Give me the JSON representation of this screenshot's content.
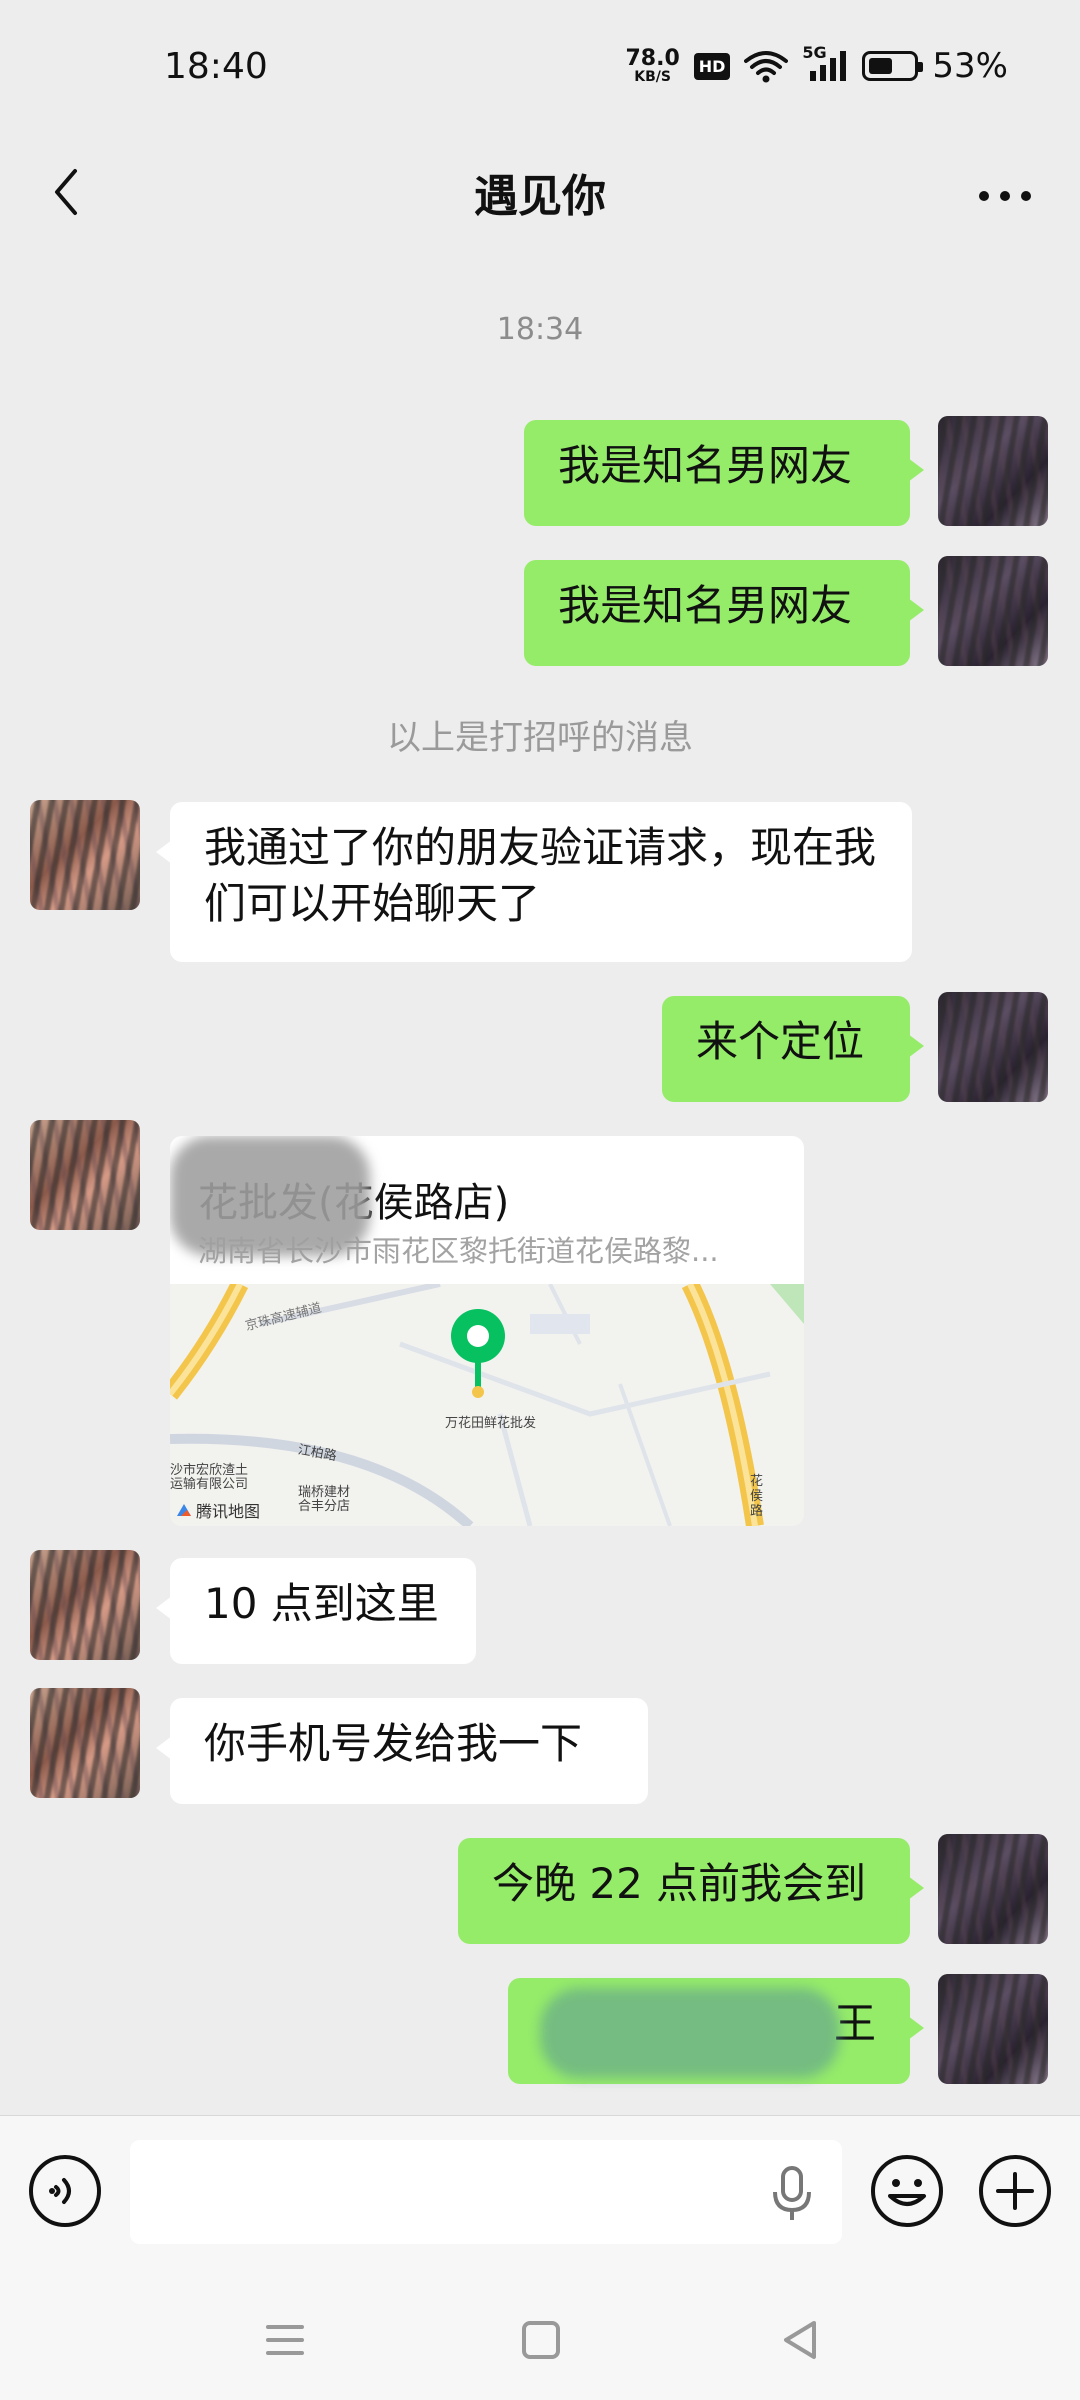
{
  "status_bar": {
    "time": "18:40",
    "net_speed_value": "78.0",
    "net_speed_unit": "KB/S",
    "hd_label": "HD",
    "signal_label": "5G",
    "battery_level": 0.53,
    "battery_text": "53%"
  },
  "header": {
    "title": "遇见你"
  },
  "chat": {
    "timestamp": "18:34",
    "greeting_notice": "以上是打招呼的消息",
    "messages": [
      {
        "from": "me",
        "text": "我是知名男网友"
      },
      {
        "from": "me",
        "text": "我是知名男网友"
      },
      {
        "from": "other",
        "text": "我通过了你的朋友验证请求，现在我们可以开始聊天了"
      },
      {
        "from": "me",
        "text": "来个定位"
      },
      {
        "from": "other",
        "type": "location",
        "name": "花批发(花侯路店)",
        "address": "湖南省长沙市雨花区黎托街道花侯路黎...",
        "map_labels": {
          "pin": "万花田鲜花批发",
          "road_1": "京珠高速辅道",
          "road_2": "江柏路",
          "road_3": "花侯路",
          "poi_1": "沙市宏欣渣土运输有限公司",
          "poi_2": "瑞桥建材合丰分店"
        },
        "map_brand": "腾讯地图"
      },
      {
        "from": "other",
        "text": "10 点到这里"
      },
      {
        "from": "other",
        "text": "你手机号发给我一下"
      },
      {
        "from": "me",
        "text": "今晚 22 点前我会到"
      },
      {
        "from": "me",
        "text": "王",
        "partially_redacted": true
      }
    ]
  },
  "input_bar": {
    "placeholder": ""
  },
  "colors": {
    "background": "#ededed",
    "outgoing_bubble": "#95ec69",
    "incoming_bubble": "#ffffff",
    "map_pin": "#07c160"
  },
  "icons": [
    "back-icon",
    "more-icon",
    "voice-icon",
    "mic-icon",
    "emoji-icon",
    "plus-icon",
    "wifi-icon",
    "signal-icon",
    "battery-icon",
    "menu-icon",
    "home-icon",
    "back-triangle-icon"
  ]
}
